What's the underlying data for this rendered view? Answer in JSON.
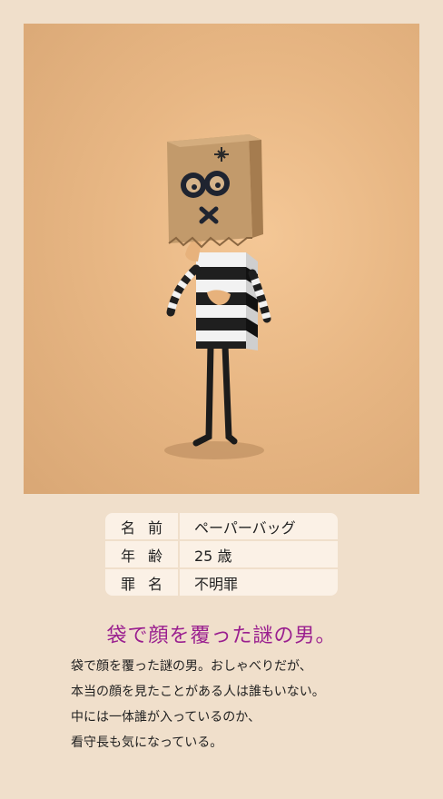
{
  "character": {
    "image_alt": "ペーパーバッグ illustration",
    "profile": [
      {
        "label": "名前",
        "value": "ペーパーバッグ"
      },
      {
        "label": "年齢",
        "value": "25 歳"
      },
      {
        "label": "罪名",
        "value": "不明罪"
      }
    ],
    "headline": "袋で顔を覆った謎の男。",
    "description_lines": [
      "袋で顔を覆った謎の男。おしゃべりだが、",
      "本当の顔を見たことがある人は誰もいない。",
      "中には一体誰が入っているのか、",
      "看守長も気になっている。"
    ]
  },
  "colors": {
    "background": "#f0dfcb",
    "headline": "#9a1f8f",
    "bag": "#c29a6b"
  }
}
